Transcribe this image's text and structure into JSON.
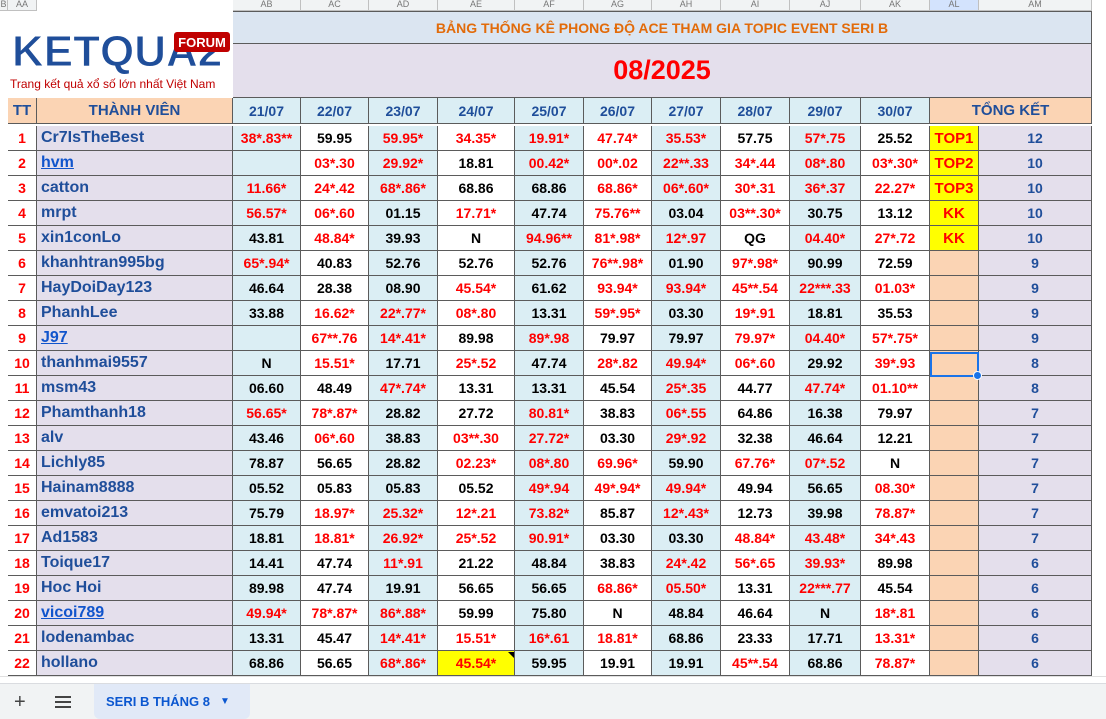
{
  "column_letters": [
    "B",
    "AA",
    "AB",
    "AC",
    "AD",
    "AE",
    "AF",
    "AG",
    "AH",
    "AI",
    "AJ",
    "AK",
    "AL",
    "AM"
  ],
  "title": "BẢNG THỐNG KÊ PHONG ĐỘ ACE THAM GIA TOPIC EVENT SERI B",
  "month": "08/2025",
  "logo": {
    "brand": "KETQUA2",
    "badge": "FORUM",
    "tagline": "Trang kết quả xổ số lớn nhất Việt Nam"
  },
  "headers": {
    "tt": "TT",
    "member": "THÀNH VIÊN",
    "summary": "TỔNG KẾT"
  },
  "dates": [
    "21/07",
    "22/07",
    "23/07",
    "24/07",
    "25/07",
    "26/07",
    "27/07",
    "28/07",
    "29/07",
    "30/07"
  ],
  "rows": [
    {
      "tt": "1",
      "name": "Cr7IsTheBest",
      "link": false,
      "vals": [
        "38*.83**",
        "59.95",
        "59.95*",
        "34.35*",
        "19.91*",
        "47.74*",
        "35.53*",
        "57.75",
        "57*.75",
        "25.52"
      ],
      "red": [
        1,
        0,
        1,
        1,
        1,
        1,
        1,
        0,
        1,
        0
      ],
      "rank": "TOP1",
      "total": "12"
    },
    {
      "tt": "2",
      "name": "hvm",
      "link": true,
      "vals": [
        "",
        "03*.30",
        "29.92*",
        "18.81",
        "00.42*",
        "00*.02",
        "22**.33",
        "34*.44",
        "08*.80",
        "03*.30*"
      ],
      "red": [
        0,
        1,
        1,
        0,
        1,
        1,
        1,
        1,
        1,
        1
      ],
      "rank": "TOP2",
      "total": "10"
    },
    {
      "tt": "3",
      "name": "catton",
      "link": false,
      "vals": [
        "11.66*",
        "24*.42",
        "68*.86*",
        "68.86",
        "68.86",
        "68.86*",
        "06*.60*",
        "30*.31",
        "36*.37",
        "22.27*"
      ],
      "red": [
        1,
        1,
        1,
        0,
        0,
        1,
        1,
        1,
        1,
        1
      ],
      "rank": "TOP3",
      "total": "10"
    },
    {
      "tt": "4",
      "name": "mrpt",
      "link": false,
      "vals": [
        "56.57*",
        "06*.60",
        "01.15",
        "17.71*",
        "47.74",
        "75.76**",
        "03.04",
        "03**.30*",
        "30.75",
        "13.12"
      ],
      "red": [
        1,
        1,
        0,
        1,
        0,
        1,
        0,
        1,
        0,
        0
      ],
      "rank": "KK",
      "total": "10"
    },
    {
      "tt": "5",
      "name": "xin1conLo",
      "link": false,
      "vals": [
        "43.81",
        "48.84*",
        "39.93",
        "N",
        "94.96**",
        "81*.98*",
        "12*.97",
        "QG",
        "04.40*",
        "27*.72"
      ],
      "red": [
        0,
        1,
        0,
        0,
        1,
        1,
        1,
        0,
        1,
        1
      ],
      "rank": "KK",
      "total": "10"
    },
    {
      "tt": "6",
      "name": "khanhtran995bg",
      "link": false,
      "vals": [
        "65*.94*",
        "40.83",
        "52.76",
        "52.76",
        "52.76",
        "76**.98*",
        "01.90",
        "97*.98*",
        "90.99",
        "72.59"
      ],
      "red": [
        1,
        0,
        0,
        0,
        0,
        1,
        0,
        1,
        0,
        0
      ],
      "rank": "",
      "total": "9"
    },
    {
      "tt": "7",
      "name": "HayDoiDay123",
      "link": false,
      "vals": [
        "46.64",
        "28.38",
        "08.90",
        "45.54*",
        "61.62",
        "93.94*",
        "93.94*",
        "45**.54",
        "22***.33",
        "01.03*"
      ],
      "red": [
        0,
        0,
        0,
        1,
        0,
        1,
        1,
        1,
        1,
        1
      ],
      "rank": "",
      "total": "9"
    },
    {
      "tt": "8",
      "name": "PhanhLee",
      "link": false,
      "vals": [
        "33.88",
        "16.62*",
        "22*.77*",
        "08*.80",
        "13.31",
        "59*.95*",
        "03.30",
        "19*.91",
        "18.81",
        "35.53"
      ],
      "red": [
        0,
        1,
        1,
        1,
        0,
        1,
        0,
        1,
        0,
        0
      ],
      "rank": "",
      "total": "9"
    },
    {
      "tt": "9",
      "name": "J97",
      "link": true,
      "vals": [
        "",
        "67**.76",
        "14*.41*",
        "89.98",
        "89*.98",
        "79.97",
        "79.97",
        "79.97*",
        "04.40*",
        "57*.75*"
      ],
      "red": [
        0,
        1,
        1,
        0,
        1,
        0,
        0,
        1,
        1,
        1
      ],
      "rank": "",
      "total": "9"
    },
    {
      "tt": "10",
      "name": "thanhmai9557",
      "link": false,
      "vals": [
        "N",
        "15.51*",
        "17.71",
        "25*.52",
        "47.74",
        "28*.82",
        "49.94*",
        "06*.60",
        "29.92",
        "39*.93"
      ],
      "red": [
        0,
        1,
        0,
        1,
        0,
        1,
        1,
        1,
        0,
        1
      ],
      "rank": "",
      "total": "8"
    },
    {
      "tt": "11",
      "name": "msm43",
      "link": false,
      "vals": [
        "06.60",
        "48.49",
        "47*.74*",
        "13.31",
        "13.31",
        "45.54",
        "25*.35",
        "44.77",
        "47.74*",
        "01.10**"
      ],
      "red": [
        0,
        0,
        1,
        0,
        0,
        0,
        1,
        0,
        1,
        1
      ],
      "rank": "",
      "total": "8"
    },
    {
      "tt": "12",
      "name": "Phamthanh18",
      "link": false,
      "vals": [
        "56.65*",
        "78*.87*",
        "28.82",
        "27.72",
        "80.81*",
        "38.83",
        "06*.55",
        "64.86",
        "16.38",
        "79.97"
      ],
      "red": [
        1,
        1,
        0,
        0,
        1,
        0,
        1,
        0,
        0,
        0
      ],
      "rank": "",
      "total": "7"
    },
    {
      "tt": "13",
      "name": "alv",
      "link": false,
      "vals": [
        "43.46",
        "06*.60",
        "38.83",
        "03**.30",
        "27.72*",
        "03.30",
        "29*.92",
        "32.38",
        "46.64",
        "12.21"
      ],
      "red": [
        0,
        1,
        0,
        1,
        1,
        0,
        1,
        0,
        0,
        0
      ],
      "rank": "",
      "total": "7"
    },
    {
      "tt": "14",
      "name": "Lichly85",
      "link": false,
      "vals": [
        "78.87",
        "56.65",
        "28.82",
        "02.23*",
        "08*.80",
        "69.96*",
        "59.90",
        "67.76*",
        "07*.52",
        "N"
      ],
      "red": [
        0,
        0,
        0,
        1,
        1,
        1,
        0,
        1,
        1,
        0
      ],
      "rank": "",
      "total": "7"
    },
    {
      "tt": "15",
      "name": "Hainam8888",
      "link": false,
      "vals": [
        "05.52",
        "05.83",
        "05.83",
        "05.52",
        "49*.94",
        "49*.94*",
        "49.94*",
        "49.94",
        "56.65",
        "08.30*"
      ],
      "red": [
        0,
        0,
        0,
        0,
        1,
        1,
        1,
        0,
        0,
        1
      ],
      "rank": "",
      "total": "7"
    },
    {
      "tt": "16",
      "name": "emvatoi213",
      "link": false,
      "vals": [
        "75.79",
        "18.97*",
        "25.32*",
        "12*.21",
        "73.82*",
        "85.87",
        "12*.43*",
        "12.73",
        "39.98",
        "78.87*"
      ],
      "red": [
        0,
        1,
        1,
        1,
        1,
        0,
        1,
        0,
        0,
        1
      ],
      "rank": "",
      "total": "7"
    },
    {
      "tt": "17",
      "name": "Ad1583",
      "link": false,
      "vals": [
        "18.81",
        "18.81*",
        "26.92*",
        "25*.52",
        "90.91*",
        "03.30",
        "03.30",
        "48.84*",
        "43.48*",
        "34*.43"
      ],
      "red": [
        0,
        1,
        1,
        1,
        1,
        0,
        0,
        1,
        1,
        1
      ],
      "rank": "",
      "total": "7"
    },
    {
      "tt": "18",
      "name": "Toique17",
      "link": false,
      "vals": [
        "14.41",
        "47.74",
        "11*.91",
        "21.22",
        "48.84",
        "38.83",
        "24*.42",
        "56*.65",
        "39.93*",
        "89.98"
      ],
      "red": [
        0,
        0,
        1,
        0,
        0,
        0,
        1,
        1,
        1,
        0
      ],
      "rank": "",
      "total": "6"
    },
    {
      "tt": "19",
      "name": "Hoc Hoi",
      "link": false,
      "vals": [
        "89.98",
        "47.74",
        "19.91",
        "56.65",
        "56.65",
        "68.86*",
        "05.50*",
        "13.31",
        "22***.77",
        "45.54"
      ],
      "red": [
        0,
        0,
        0,
        0,
        0,
        1,
        1,
        0,
        1,
        0
      ],
      "rank": "",
      "total": "6"
    },
    {
      "tt": "20",
      "name": "vicoi789",
      "link": true,
      "vals": [
        "49.94*",
        "78*.87*",
        "86*.88*",
        "59.99",
        "75.80",
        "N",
        "48.84",
        "46.64",
        "N",
        "18*.81"
      ],
      "red": [
        1,
        1,
        1,
        0,
        0,
        0,
        0,
        0,
        0,
        1
      ],
      "rank": "",
      "total": "6"
    },
    {
      "tt": "21",
      "name": "lodenambac",
      "link": false,
      "vals": [
        "13.31",
        "45.47",
        "14*.41*",
        "15.51*",
        "16*.61",
        "18.81*",
        "68.86",
        "23.33",
        "17.71",
        "13.31*"
      ],
      "red": [
        0,
        0,
        1,
        1,
        1,
        1,
        0,
        0,
        0,
        1
      ],
      "rank": "",
      "total": "6"
    },
    {
      "tt": "22",
      "name": "hollano",
      "link": false,
      "vals": [
        "68.86",
        "56.65",
        "68*.86*",
        "45.54*",
        "59.95",
        "19.91",
        "19.91",
        "45**.54",
        "68.86",
        "78.87*"
      ],
      "red": [
        0,
        0,
        1,
        1,
        0,
        0,
        0,
        1,
        0,
        1
      ],
      "rank": "",
      "total": "6"
    }
  ],
  "sheet_tab": {
    "label": "SERI B THÁNG 8"
  }
}
